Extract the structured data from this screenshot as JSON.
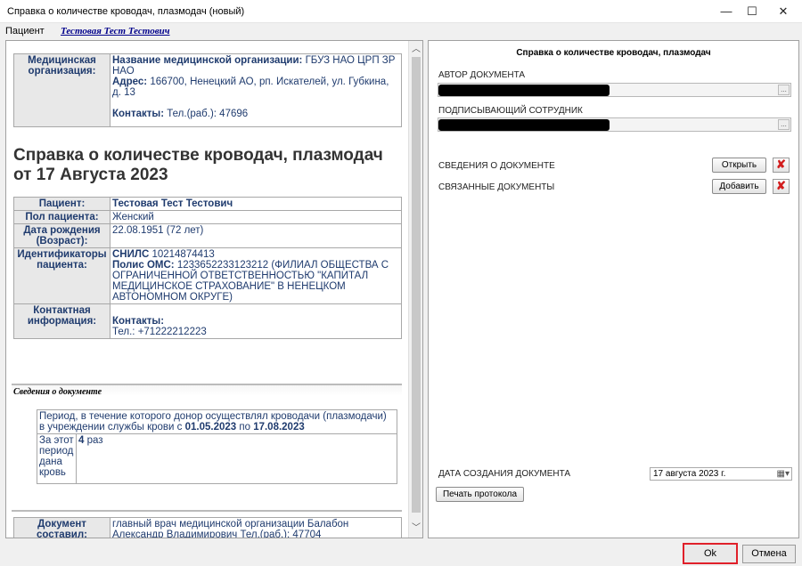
{
  "window": {
    "title": "Справка о количестве кроводач, плазмодач (новый)",
    "minimize": "—",
    "maximize": "☐",
    "close": "✕"
  },
  "patient_bar": {
    "label": "Пациент",
    "link": "Тестовая Тест Тестович"
  },
  "document": {
    "org_header": "Медицинская организация:",
    "org_name_label": "Название медицинской организации:",
    "org_name_value": "ГБУЗ НАО ЦРП ЗР НАО",
    "org_address_label": "Адрес:",
    "org_address_value": "166700, Ненецкий АО, рп. Искателей, ул. Губкина, д. 13",
    "org_contacts_label": "Контакты:",
    "org_contacts_value": "Тел.(раб.): 47696",
    "title": "Справка о количестве кроводач, плазмодач от 17 Августа 2023",
    "patient_rows": [
      {
        "label": "Пациент:",
        "value": "Тестовая Тест Тестович"
      },
      {
        "label": "Пол пациента:",
        "value": "Женский"
      },
      {
        "label": "Дата рождения (Возраст):",
        "value": "22.08.1951 (72 лет)"
      }
    ],
    "ids_label": "Идентификаторы пациента:",
    "snils_label": "СНИЛС",
    "snils_value": "10214874413",
    "oms_label": "Полис ОМС:",
    "oms_value": "1233652233123212 (ФИЛИАЛ ОБЩЕСТВА С ОГРАНИЧЕННОЙ ОТВЕТСТВЕННОСТЬЮ \"КАПИТАЛ МЕДИЦИНСКОЕ СТРАХОВАНИЕ\" В НЕНЕЦКОМ АВТОНОМНОМ ОКРУГЕ)",
    "contact_label": "Контактная информация:",
    "contact_sub": "Контакты:",
    "contact_value": "Тел.: +71222212223",
    "section_title": "Сведения о документе",
    "period_text_1": "Период, в течение которого донор осуществлял кроводачи (плазмодачи) в учреждении службы крови с ",
    "period_from": "01.05.2023",
    "period_mid": " по ",
    "period_to": "17.08.2023",
    "donations_label": "За этот период дана кровь",
    "donations_count": "4",
    "donations_unit": " раз",
    "composer_label": "Документ составил:",
    "composer_value": "главный врач медицинской организации Балабон Александр Владимирович Тел.(раб.): 47704"
  },
  "right_panel": {
    "title": "Справка о количестве кроводач, плазмодач",
    "author_label": "АВТОР ДОКУМЕНТА",
    "signer_label": "ПОДПИСЫВАЮЩИЙ СОТРУДНИК",
    "ellipsis": "...",
    "doc_info_label": "СВЕДЕНИЯ О ДОКУМЕНТЕ",
    "open_btn": "Открыть",
    "related_label": "СВЯЗАННЫЕ ДОКУМЕНТЫ",
    "add_btn": "Добавить",
    "created_label": "ДАТА СОЗДАНИЯ ДОКУМЕНТА",
    "created_value": "17  августа  2023 г.",
    "print_btn": "Печать протокола"
  },
  "footer": {
    "ok": "Ok",
    "cancel": "Отмена"
  },
  "colors": {
    "ok_highlight": "#e0202a",
    "delete_icon": "#d21d1d",
    "text_blue": "#1f3b6e"
  }
}
